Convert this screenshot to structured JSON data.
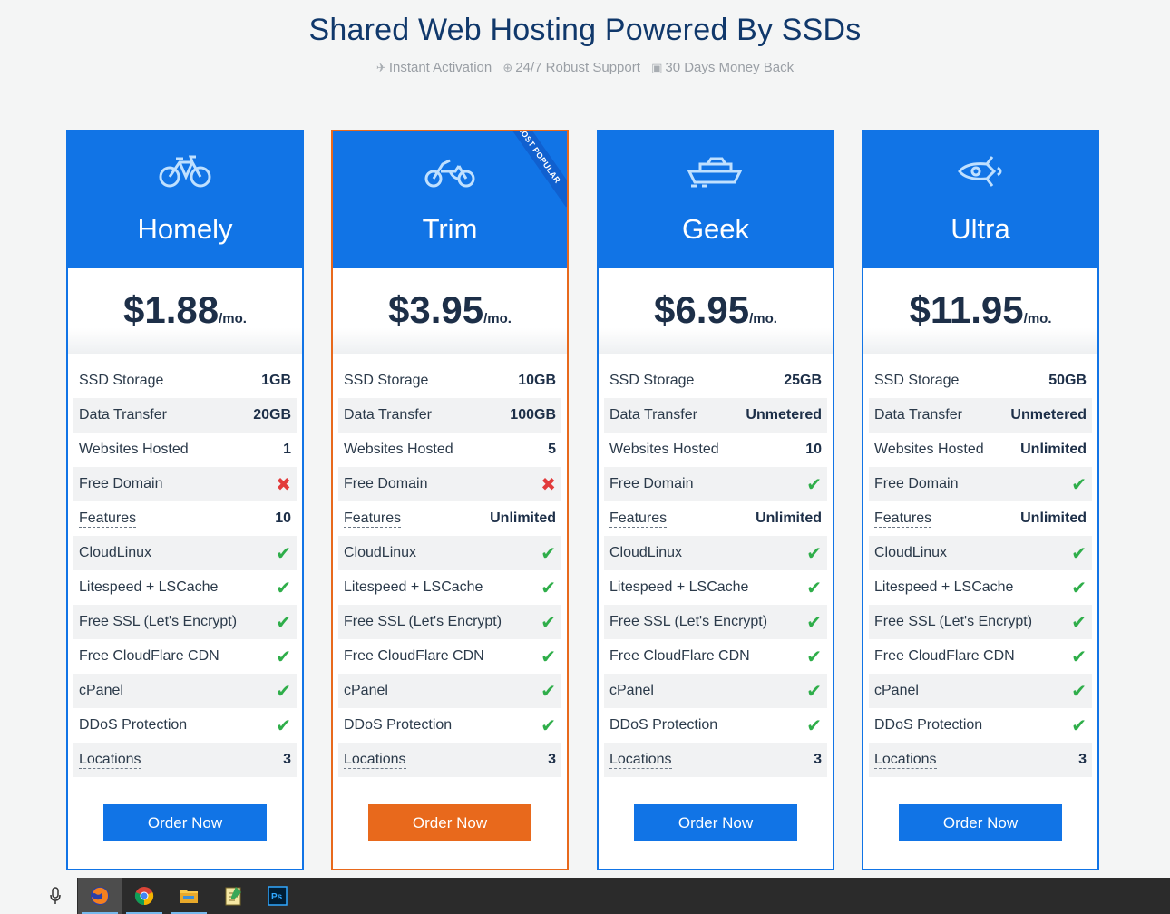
{
  "header": {
    "title": "Shared Web Hosting Powered By SSDs",
    "features": [
      {
        "icon": "plane-icon",
        "label": "Instant Activation"
      },
      {
        "icon": "lifebuoy-icon",
        "label": "24/7 Robust Support"
      },
      {
        "icon": "money-icon",
        "label": "30 Days Money Back"
      }
    ]
  },
  "colors": {
    "primary": "#1174e6",
    "accent": "#e8691c",
    "check": "#2fae4a",
    "cross": "#e23b3b"
  },
  "plans": [
    {
      "name": "Homely",
      "icon": "bicycle-icon",
      "price": "$1.88",
      "per": "/mo.",
      "ribbon": "",
      "order_label": "Order Now",
      "features": [
        {
          "label": "SSD Storage",
          "value": "1GB"
        },
        {
          "label": "Data Transfer",
          "value": "20GB"
        },
        {
          "label": "Websites Hosted",
          "value": "1"
        },
        {
          "label": "Free Domain",
          "value": "cross"
        },
        {
          "label": "Features",
          "value": "10"
        },
        {
          "label": "CloudLinux",
          "value": "check"
        },
        {
          "label": "Litespeed + LSCache",
          "value": "check"
        },
        {
          "label": "Free SSL (Let's Encrypt)",
          "value": "check"
        },
        {
          "label": "Free CloudFlare CDN",
          "value": "check"
        },
        {
          "label": "cPanel",
          "value": "check"
        },
        {
          "label": "DDoS Protection",
          "value": "check"
        },
        {
          "label": "Locations",
          "value": "3"
        }
      ]
    },
    {
      "name": "Trim",
      "icon": "motorbike-icon",
      "price": "$3.95",
      "per": "/mo.",
      "ribbon": "MOST POPULAR",
      "order_label": "Order Now",
      "features": [
        {
          "label": "SSD Storage",
          "value": "10GB"
        },
        {
          "label": "Data Transfer",
          "value": "100GB"
        },
        {
          "label": "Websites Hosted",
          "value": "5"
        },
        {
          "label": "Free Domain",
          "value": "cross"
        },
        {
          "label": "Features",
          "value": "Unlimited"
        },
        {
          "label": "CloudLinux",
          "value": "check"
        },
        {
          "label": "Litespeed + LSCache",
          "value": "check"
        },
        {
          "label": "Free SSL (Let's Encrypt)",
          "value": "check"
        },
        {
          "label": "Free CloudFlare CDN",
          "value": "check"
        },
        {
          "label": "cPanel",
          "value": "check"
        },
        {
          "label": "DDoS Protection",
          "value": "check"
        },
        {
          "label": "Locations",
          "value": "3"
        }
      ]
    },
    {
      "name": "Geek",
      "icon": "ship-icon",
      "price": "$6.95",
      "per": "/mo.",
      "ribbon": "",
      "order_label": "Order Now",
      "features": [
        {
          "label": "SSD Storage",
          "value": "25GB"
        },
        {
          "label": "Data Transfer",
          "value": "Unmetered"
        },
        {
          "label": "Websites Hosted",
          "value": "10"
        },
        {
          "label": "Free Domain",
          "value": "check"
        },
        {
          "label": "Features",
          "value": "Unlimited"
        },
        {
          "label": "CloudLinux",
          "value": "check"
        },
        {
          "label": "Litespeed + LSCache",
          "value": "check"
        },
        {
          "label": "Free SSL (Let's Encrypt)",
          "value": "check"
        },
        {
          "label": "Free CloudFlare CDN",
          "value": "check"
        },
        {
          "label": "cPanel",
          "value": "check"
        },
        {
          "label": "DDoS Protection",
          "value": "check"
        },
        {
          "label": "Locations",
          "value": "3"
        }
      ]
    },
    {
      "name": "Ultra",
      "icon": "rocket-icon",
      "price": "$11.95",
      "per": "/mo.",
      "ribbon": "",
      "order_label": "Order Now",
      "features": [
        {
          "label": "SSD Storage",
          "value": "50GB"
        },
        {
          "label": "Data Transfer",
          "value": "Unmetered"
        },
        {
          "label": "Websites Hosted",
          "value": "Unlimited"
        },
        {
          "label": "Free Domain",
          "value": "check"
        },
        {
          "label": "Features",
          "value": "Unlimited"
        },
        {
          "label": "CloudLinux",
          "value": "check"
        },
        {
          "label": "Litespeed + LSCache",
          "value": "check"
        },
        {
          "label": "Free SSL (Let's Encrypt)",
          "value": "check"
        },
        {
          "label": "Free CloudFlare CDN",
          "value": "check"
        },
        {
          "label": "cPanel",
          "value": "check"
        },
        {
          "label": "DDoS Protection",
          "value": "check"
        },
        {
          "label": "Locations",
          "value": "3"
        }
      ]
    }
  ],
  "taskbar": {
    "apps": [
      {
        "icon": "microphone-icon"
      },
      {
        "icon": "firefox-icon",
        "active": true
      },
      {
        "icon": "chrome-icon"
      },
      {
        "icon": "file-explorer-icon"
      },
      {
        "icon": "notepad-icon"
      },
      {
        "icon": "photoshop-icon",
        "label": "Ps"
      }
    ]
  }
}
